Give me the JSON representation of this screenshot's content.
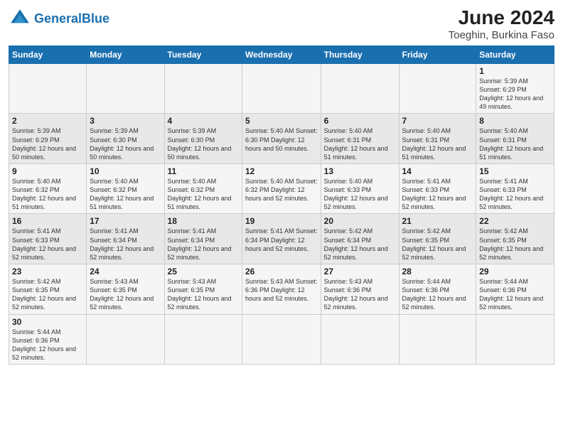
{
  "header": {
    "logo_general": "General",
    "logo_blue": "Blue",
    "title": "June 2024",
    "subtitle": "Toeghin, Burkina Faso"
  },
  "weekdays": [
    "Sunday",
    "Monday",
    "Tuesday",
    "Wednesday",
    "Thursday",
    "Friday",
    "Saturday"
  ],
  "weeks": [
    [
      {
        "day": "",
        "info": ""
      },
      {
        "day": "",
        "info": ""
      },
      {
        "day": "",
        "info": ""
      },
      {
        "day": "",
        "info": ""
      },
      {
        "day": "",
        "info": ""
      },
      {
        "day": "",
        "info": ""
      },
      {
        "day": "1",
        "info": "Sunrise: 5:39 AM\nSunset: 6:29 PM\nDaylight: 12 hours and 49 minutes."
      }
    ],
    [
      {
        "day": "2",
        "info": "Sunrise: 5:39 AM\nSunset: 6:29 PM\nDaylight: 12 hours and 50 minutes."
      },
      {
        "day": "3",
        "info": "Sunrise: 5:39 AM\nSunset: 6:30 PM\nDaylight: 12 hours and 50 minutes."
      },
      {
        "day": "4",
        "info": "Sunrise: 5:39 AM\nSunset: 6:30 PM\nDaylight: 12 hours and 50 minutes."
      },
      {
        "day": "5",
        "info": "Sunrise: 5:40 AM\nSunset: 6:30 PM\nDaylight: 12 hours and 50 minutes."
      },
      {
        "day": "6",
        "info": "Sunrise: 5:40 AM\nSunset: 6:31 PM\nDaylight: 12 hours and 51 minutes."
      },
      {
        "day": "7",
        "info": "Sunrise: 5:40 AM\nSunset: 6:31 PM\nDaylight: 12 hours and 51 minutes."
      },
      {
        "day": "8",
        "info": "Sunrise: 5:40 AM\nSunset: 6:31 PM\nDaylight: 12 hours and 51 minutes."
      }
    ],
    [
      {
        "day": "9",
        "info": "Sunrise: 5:40 AM\nSunset: 6:32 PM\nDaylight: 12 hours and 51 minutes."
      },
      {
        "day": "10",
        "info": "Sunrise: 5:40 AM\nSunset: 6:32 PM\nDaylight: 12 hours and 51 minutes."
      },
      {
        "day": "11",
        "info": "Sunrise: 5:40 AM\nSunset: 6:32 PM\nDaylight: 12 hours and 51 minutes."
      },
      {
        "day": "12",
        "info": "Sunrise: 5:40 AM\nSunset: 6:32 PM\nDaylight: 12 hours and 52 minutes."
      },
      {
        "day": "13",
        "info": "Sunrise: 5:40 AM\nSunset: 6:33 PM\nDaylight: 12 hours and 52 minutes."
      },
      {
        "day": "14",
        "info": "Sunrise: 5:41 AM\nSunset: 6:33 PM\nDaylight: 12 hours and 52 minutes."
      },
      {
        "day": "15",
        "info": "Sunrise: 5:41 AM\nSunset: 6:33 PM\nDaylight: 12 hours and 52 minutes."
      }
    ],
    [
      {
        "day": "16",
        "info": "Sunrise: 5:41 AM\nSunset: 6:33 PM\nDaylight: 12 hours and 52 minutes."
      },
      {
        "day": "17",
        "info": "Sunrise: 5:41 AM\nSunset: 6:34 PM\nDaylight: 12 hours and 52 minutes."
      },
      {
        "day": "18",
        "info": "Sunrise: 5:41 AM\nSunset: 6:34 PM\nDaylight: 12 hours and 52 minutes."
      },
      {
        "day": "19",
        "info": "Sunrise: 5:41 AM\nSunset: 6:34 PM\nDaylight: 12 hours and 52 minutes."
      },
      {
        "day": "20",
        "info": "Sunrise: 5:42 AM\nSunset: 6:34 PM\nDaylight: 12 hours and 52 minutes."
      },
      {
        "day": "21",
        "info": "Sunrise: 5:42 AM\nSunset: 6:35 PM\nDaylight: 12 hours and 52 minutes."
      },
      {
        "day": "22",
        "info": "Sunrise: 5:42 AM\nSunset: 6:35 PM\nDaylight: 12 hours and 52 minutes."
      }
    ],
    [
      {
        "day": "23",
        "info": "Sunrise: 5:42 AM\nSunset: 6:35 PM\nDaylight: 12 hours and 52 minutes."
      },
      {
        "day": "24",
        "info": "Sunrise: 5:43 AM\nSunset: 6:35 PM\nDaylight: 12 hours and 52 minutes."
      },
      {
        "day": "25",
        "info": "Sunrise: 5:43 AM\nSunset: 6:35 PM\nDaylight: 12 hours and 52 minutes."
      },
      {
        "day": "26",
        "info": "Sunrise: 5:43 AM\nSunset: 6:36 PM\nDaylight: 12 hours and 52 minutes."
      },
      {
        "day": "27",
        "info": "Sunrise: 5:43 AM\nSunset: 6:36 PM\nDaylight: 12 hours and 52 minutes."
      },
      {
        "day": "28",
        "info": "Sunrise: 5:44 AM\nSunset: 6:36 PM\nDaylight: 12 hours and 52 minutes."
      },
      {
        "day": "29",
        "info": "Sunrise: 5:44 AM\nSunset: 6:36 PM\nDaylight: 12 hours and 52 minutes."
      }
    ],
    [
      {
        "day": "30",
        "info": "Sunrise: 5:44 AM\nSunset: 6:36 PM\nDaylight: 12 hours and 52 minutes."
      },
      {
        "day": "",
        "info": ""
      },
      {
        "day": "",
        "info": ""
      },
      {
        "day": "",
        "info": ""
      },
      {
        "day": "",
        "info": ""
      },
      {
        "day": "",
        "info": ""
      },
      {
        "day": "",
        "info": ""
      }
    ]
  ]
}
